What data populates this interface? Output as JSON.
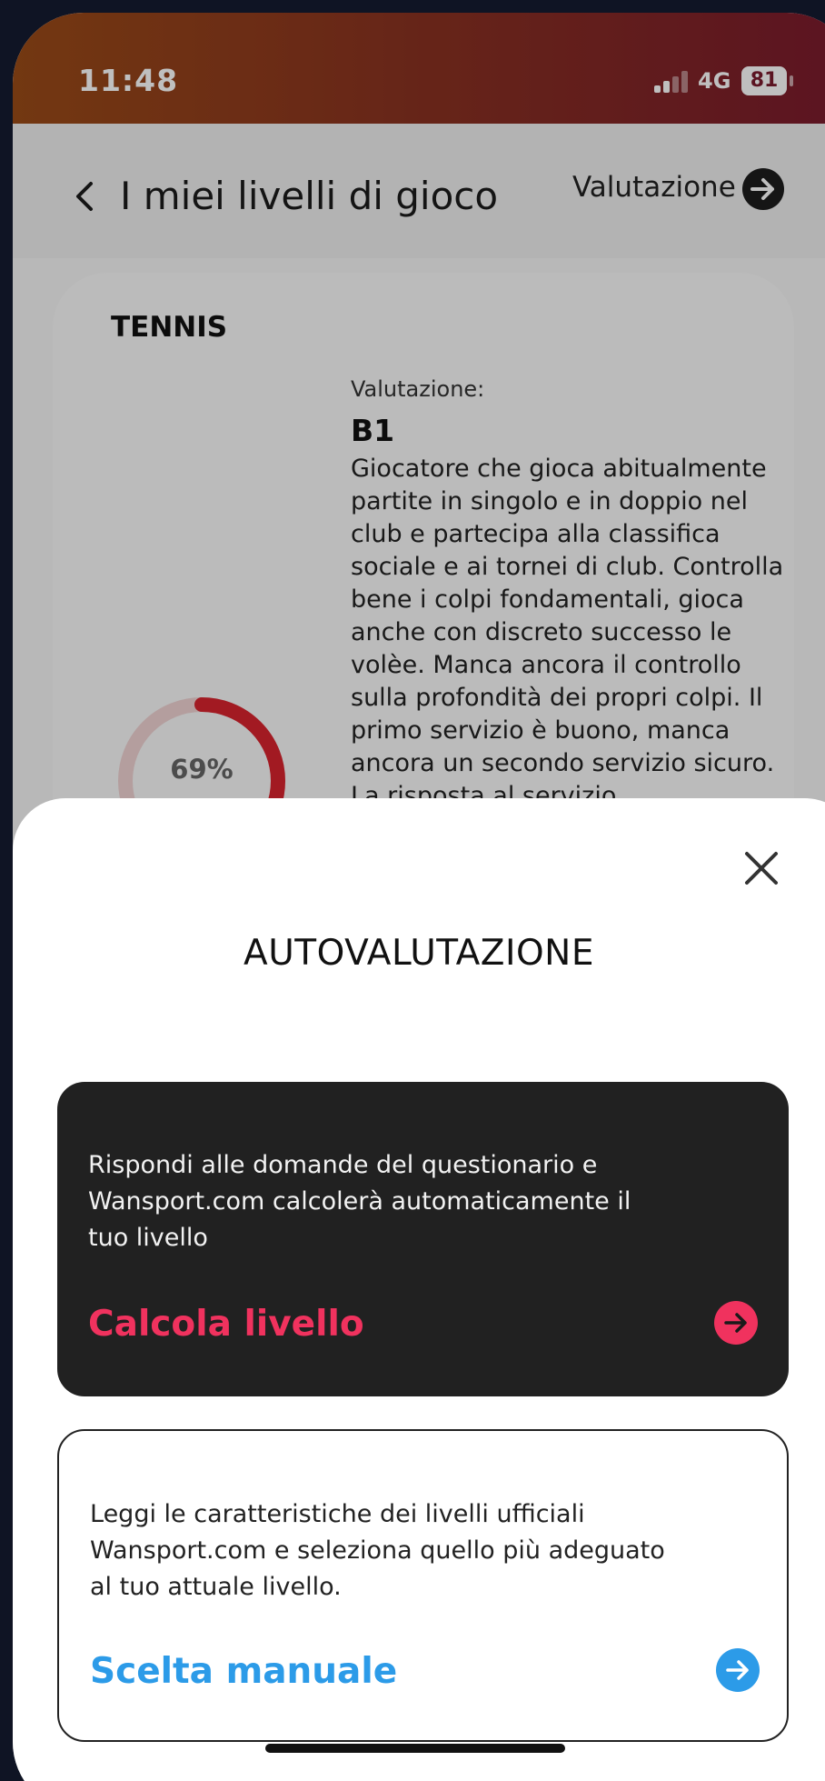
{
  "status_bar": {
    "time": "11:48",
    "network": "4G",
    "battery": "81"
  },
  "header": {
    "title": "I miei livelli di gioco",
    "evaluation_link": "Valutazione"
  },
  "level_card": {
    "sport": "TENNIS",
    "evaluation_label": "Valutazione:",
    "level": "B1",
    "description": "Giocatore che gioca abitualmente partite in singolo e in doppio nel club e partecipa alla classifica sociale e ai tornei di club. Controlla bene i colpi fondamentali, gioca anche con discreto successo le volèe. Manca ancora il controllo sulla profondità dei propri colpi. Il primo servizio è buono, manca ancora un secondo servizio sicuro. La risposta al servizio",
    "progress_text": "69%",
    "progress": 0.69
  },
  "sheet": {
    "title": "AUTOVALUTAZIONE",
    "option_auto": {
      "text": "Rispondi alle domande del questionario e Wansport.com calcolerà automaticamente il tuo livello",
      "action": "Calcola livello"
    },
    "option_manual": {
      "text": "Leggi le caratteristiche dei livelli ufficiali Wansport.com e seleziona quello più adeguato al tuo attuale livello.",
      "action": "Scelta manuale"
    }
  },
  "colors": {
    "accent_red": "#f0325e",
    "accent_blue": "#2c9be8",
    "ring_red": "#d8232e"
  }
}
